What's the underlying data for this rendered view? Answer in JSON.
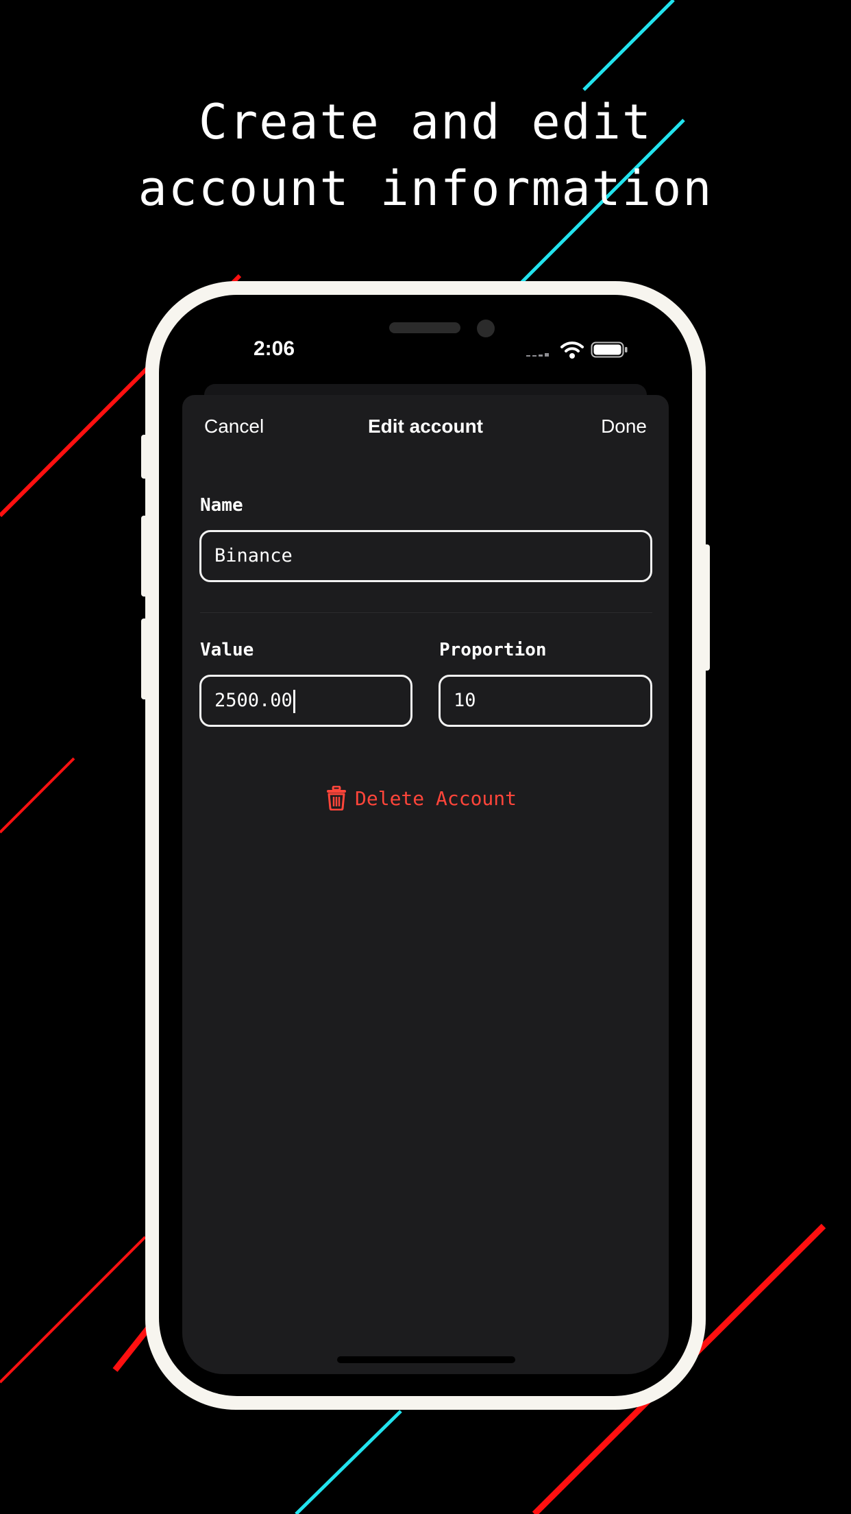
{
  "headline": {
    "line1": "Create and edit",
    "line2": "account information"
  },
  "status_bar": {
    "time": "2:06"
  },
  "nav": {
    "cancel_label": "Cancel",
    "title": "Edit account",
    "done_label": "Done"
  },
  "form": {
    "name_label": "Name",
    "name_value": "Binance",
    "value_label": "Value",
    "value_value": "2500.00",
    "proportion_label": "Proportion",
    "proportion_value": "10"
  },
  "delete": {
    "label": "Delete Account",
    "icon": "trash-icon"
  },
  "colors": {
    "background": "#000000",
    "sheet": "#1c1c1e",
    "destructive": "#ff453a",
    "accent_red": "#ff1010",
    "accent_cyan": "#22e3ee",
    "phone_frame": "#f7f5ef"
  }
}
